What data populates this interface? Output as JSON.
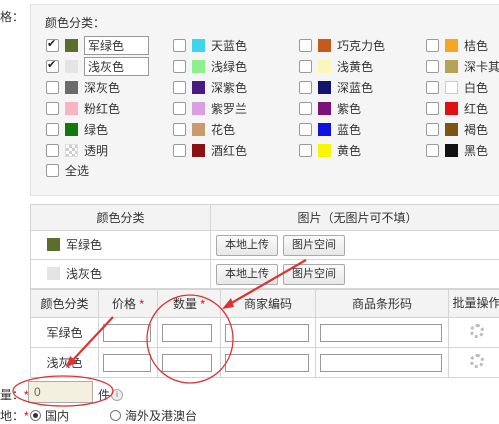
{
  "left_labels": {
    "top": "格：",
    "total_qty": "量：",
    "total_qty_required": "*",
    "location": "地：",
    "location_required": "*"
  },
  "color_panel": {
    "title": "颜色分类：",
    "items": [
      {
        "name": "军绿色",
        "swatch": "#5b6e2b",
        "checked": true,
        "editable": true
      },
      {
        "name": "天蓝色",
        "swatch": "#3dd4ee",
        "checked": false
      },
      {
        "name": "巧克力色",
        "swatch": "#c45a1b",
        "checked": false
      },
      {
        "name": "桔色",
        "swatch": "#f5a623",
        "checked": false
      },
      {
        "name": "浅灰色",
        "swatch": "#e4e4e4",
        "checked": true,
        "editable": true
      },
      {
        "name": "浅绿色",
        "swatch": "#8cf08c",
        "checked": false
      },
      {
        "name": "浅黄色",
        "swatch": "#fbf7ba",
        "checked": false
      },
      {
        "name": "深卡其布",
        "swatch": "#b5a355",
        "checked": false
      },
      {
        "name": "深灰色",
        "swatch": "#6b6b6b",
        "checked": false
      },
      {
        "name": "深紫色",
        "swatch": "#4a1b7e",
        "checked": false
      },
      {
        "name": "深蓝色",
        "swatch": "#14146f",
        "checked": false
      },
      {
        "name": "白色",
        "swatch": "#ffffff",
        "checked": false
      },
      {
        "name": "粉红色",
        "swatch": "#f5b5c2",
        "checked": false
      },
      {
        "name": "紫罗兰",
        "swatch": "#d8a0e0",
        "checked": false
      },
      {
        "name": "紫色",
        "swatch": "#7a1278",
        "checked": false
      },
      {
        "name": "红色",
        "swatch": "#e01010",
        "checked": false
      },
      {
        "name": "绿色",
        "swatch": "#0e7a0e",
        "checked": false
      },
      {
        "name": "花色",
        "swatch": "#c99a6b",
        "checked": false
      },
      {
        "name": "蓝色",
        "swatch": "#1010e0",
        "checked": false
      },
      {
        "name": "褐色",
        "swatch": "#7a5410",
        "checked": false
      },
      {
        "name": "透明",
        "swatch": "transparent",
        "checked": false
      },
      {
        "name": "酒红色",
        "swatch": "#8b1010",
        "checked": false
      },
      {
        "name": "黄色",
        "swatch": "#f7f700",
        "checked": false
      },
      {
        "name": "黑色",
        "swatch": "#111111",
        "checked": false
      }
    ],
    "select_all": "全选"
  },
  "image_table": {
    "headers": [
      "颜色分类",
      "图片（无图片可不填）"
    ],
    "rows": [
      {
        "name": "军绿色",
        "swatch": "#5b6e2b"
      },
      {
        "name": "浅灰色",
        "swatch": "#e4e4e4"
      }
    ],
    "upload_label": "本地上传",
    "space_label": "图片空间"
  },
  "sku_table": {
    "headers": {
      "color": "颜色分类",
      "price": "价格",
      "qty": "数量",
      "code": "商家编码",
      "barcode": "商品条形码",
      "batch": "批量操作"
    },
    "required_mark": "*",
    "rows": [
      "军绿色",
      "浅灰色"
    ]
  },
  "total": {
    "value": "0",
    "unit": "件"
  },
  "location": {
    "options": [
      "国内",
      "海外及港澳台"
    ],
    "selected": "国内"
  },
  "colors": {
    "annotation_red": "#d33",
    "required_red": "#e00"
  }
}
